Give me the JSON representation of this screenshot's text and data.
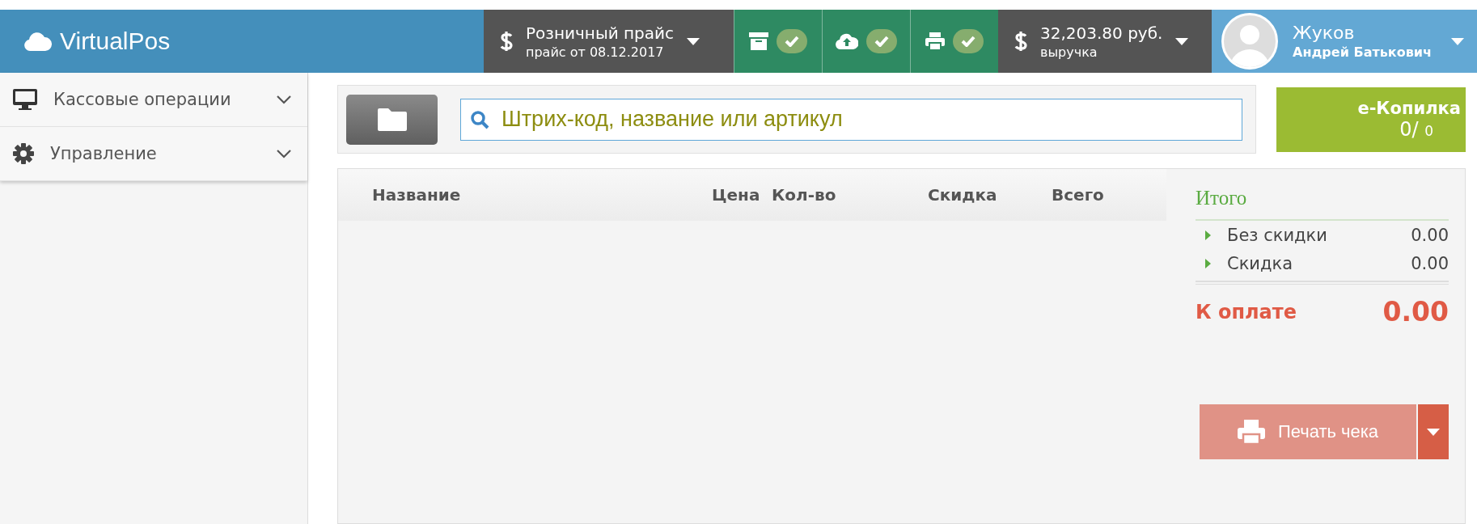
{
  "header": {
    "logo": "VirtualPos",
    "price": {
      "title": "Розничный прайс",
      "subtitle": "прайс от 08.12.2017"
    },
    "status_buttons": [
      {
        "kind": "archive",
        "checked": true
      },
      {
        "kind": "upload",
        "checked": true
      },
      {
        "kind": "printer",
        "checked": true
      }
    ],
    "revenue": {
      "amount": "32,203.80 руб.",
      "label": "выручка"
    },
    "user": {
      "surname": "Жуков",
      "name": "Андрей Батькович"
    }
  },
  "sidebar": {
    "items": [
      {
        "kind": "monitor",
        "label": "Кассовые операции",
        "expanded": false
      },
      {
        "kind": "gear",
        "label": "Управление",
        "expanded": false
      }
    ]
  },
  "search": {
    "placeholder": "Штрих-код, название или артикул"
  },
  "piggy_bank": {
    "title": "e-Копилка",
    "value": "0/",
    "total": "0"
  },
  "table": {
    "columns": [
      "Название",
      "Цена",
      "Кол-во",
      "Скидка",
      "Всего"
    ]
  },
  "totals": {
    "title": "Итого",
    "rows": [
      {
        "label": "Без скидки",
        "value": "0.00"
      },
      {
        "label": "Скидка",
        "value": "0.00"
      }
    ],
    "due_label": "К оплате",
    "due_value": "0.00",
    "print_button": "Печать чека"
  }
}
